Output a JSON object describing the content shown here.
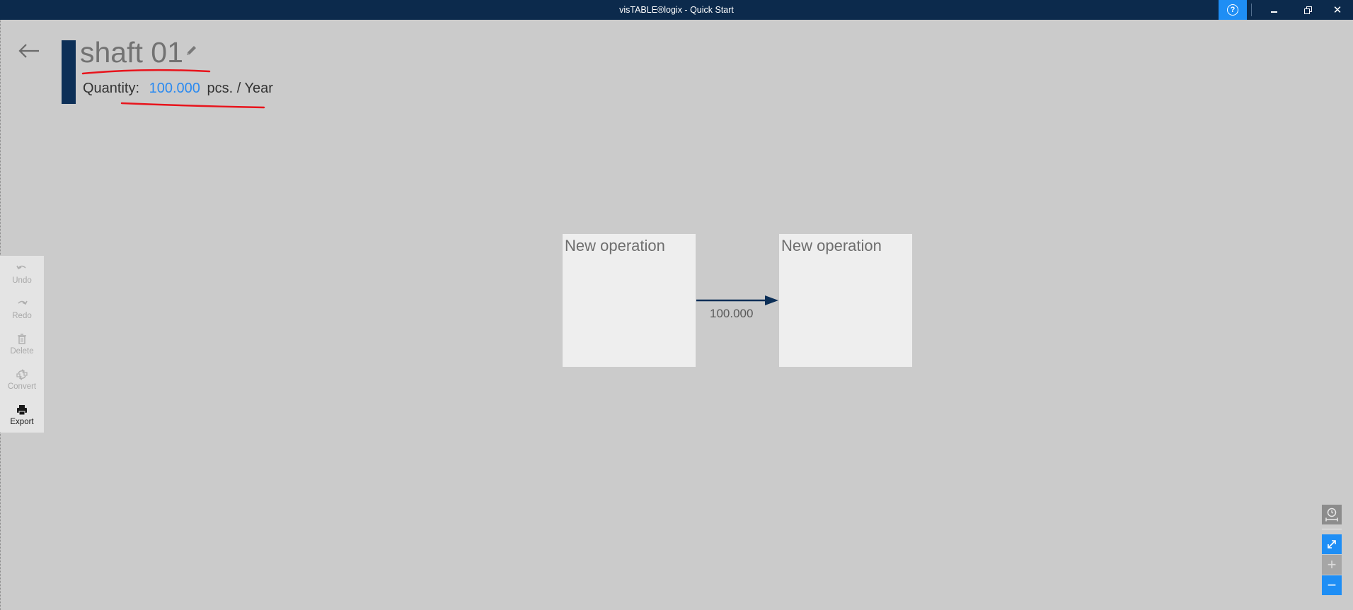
{
  "window": {
    "title": "visTABLE®logix - Quick Start",
    "help_glyph": "?",
    "close_glyph": "✕"
  },
  "header": {
    "part_name": "shaft 01",
    "quantity_label": "Quantity:",
    "quantity_value": "100.000",
    "quantity_unit": "pcs. / Year"
  },
  "toolbar": {
    "items": [
      {
        "label": "Undo",
        "icon": "undo-icon",
        "enabled": false
      },
      {
        "label": "Redo",
        "icon": "redo-icon",
        "enabled": false
      },
      {
        "label": "Delete",
        "icon": "trash-icon",
        "enabled": false
      },
      {
        "label": "Convert",
        "icon": "convert-icon",
        "enabled": false
      },
      {
        "label": "Export",
        "icon": "printer-icon",
        "enabled": true
      }
    ]
  },
  "canvas": {
    "operations": [
      {
        "title": "New operation"
      },
      {
        "title": "New operation"
      }
    ],
    "flow": {
      "label": "100.000"
    }
  },
  "view_controls": {
    "plus_glyph": "+",
    "minus_glyph": "−"
  },
  "colors": {
    "titlebar": "#0c2a4c",
    "accent": "#1e8ef5",
    "background": "#cbcbcb",
    "header_bar": "#0c2f57",
    "quantity_value": "#2b8af0",
    "annotation": "#e8141c"
  }
}
